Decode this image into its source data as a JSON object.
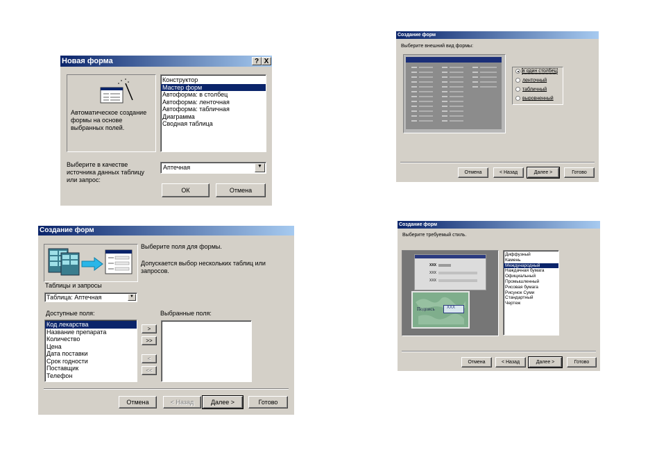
{
  "new_form": {
    "title": "Новая форма",
    "help_btn": "?",
    "close_btn": "X",
    "description": "Автоматическое создание формы на основе выбранных полей.",
    "list_items": [
      {
        "label": "Конструктор",
        "selected": false
      },
      {
        "label": "Мастер форм",
        "selected": true
      },
      {
        "label": "Автоформа: в столбец",
        "selected": false
      },
      {
        "label": "Автоформа: ленточная",
        "selected": false
      },
      {
        "label": "Автоформа: табличная",
        "selected": false
      },
      {
        "label": "Диаграмма",
        "selected": false
      },
      {
        "label": "Сводная таблица",
        "selected": false
      }
    ],
    "source_label": "Выберите в качестве источника данных таблицу или запрос:",
    "source_value": "Аптечная",
    "ok_label": "ОК",
    "cancel_label": "Отмена"
  },
  "fields_wizard": {
    "title": "Создание форм",
    "prompt": "Выберите поля для формы.",
    "hint": "Допускается выбор нескольких таблиц или запросов.",
    "tables_label": "Таблицы и запросы",
    "table_value": "Таблица: Аптечная",
    "available_label": "Доступные поля:",
    "selected_label": "Выбранные поля:",
    "available_fields": [
      {
        "label": "Код лекарства",
        "selected": true
      },
      {
        "label": "Название препарата",
        "selected": false
      },
      {
        "label": "Количество",
        "selected": false
      },
      {
        "label": "Цена",
        "selected": false
      },
      {
        "label": "Дата поставки",
        "selected": false
      },
      {
        "label": "Срок годности",
        "selected": false
      },
      {
        "label": "Поставщик",
        "selected": false
      },
      {
        "label": "Телефон",
        "selected": false
      }
    ],
    "move_one": ">",
    "move_all": ">>",
    "remove_one": "<",
    "remove_all": "<<",
    "cancel": "Отмена",
    "back": "< Назад",
    "next": "Далее >",
    "finish": "Готово"
  },
  "layout_wizard": {
    "title": "Создание форм",
    "prompt": "Выберите внешний вид формы:",
    "options": [
      {
        "label": "в один столбец",
        "checked": true
      },
      {
        "label": "ленточный",
        "checked": false
      },
      {
        "label": "табличный",
        "checked": false
      },
      {
        "label": "выровненный",
        "checked": false
      }
    ],
    "cancel": "Отмена",
    "back": "< Назад",
    "next": "Далее >",
    "finish": "Готово"
  },
  "style_wizard": {
    "title": "Создание форм",
    "prompt": "Выберите требуемый стиль.",
    "preview_xxx_1": "XXX",
    "preview_xxx_2": "XXX",
    "preview_xxx_3": "XXX",
    "preview_caption": "Подпись",
    "preview_value": "XXX",
    "styles": [
      {
        "label": "Диффузный",
        "selected": false
      },
      {
        "label": "Камень",
        "selected": false
      },
      {
        "label": "Международный",
        "selected": true
      },
      {
        "label": "Наждачная бумага",
        "selected": false
      },
      {
        "label": "Официальный",
        "selected": false
      },
      {
        "label": "Промышленный",
        "selected": false
      },
      {
        "label": "Рисовая бумага",
        "selected": false
      },
      {
        "label": "Рисунок Суми",
        "selected": false
      },
      {
        "label": "Стандартный",
        "selected": false
      },
      {
        "label": "Чертеж",
        "selected": false
      }
    ],
    "cancel": "Отмена",
    "back": "< Назад",
    "next": "Далее >",
    "finish": "Готово"
  }
}
